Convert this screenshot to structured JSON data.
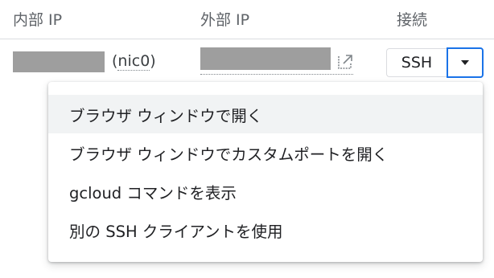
{
  "columns": {
    "internal_ip": "内部 IP",
    "external_ip": "外部 IP",
    "connect": "接続"
  },
  "row": {
    "nic": "nic0",
    "nic_open": "(",
    "nic_close": ")"
  },
  "connect_button": {
    "label": "SSH"
  },
  "menu": {
    "items": [
      {
        "label": "ブラウザ ウィンドウで開く"
      },
      {
        "label": "ブラウザ ウィンドウでカスタムポートを開く"
      },
      {
        "label": "gcloud コマンドを表示"
      },
      {
        "label": "別の SSH クライアントを使用"
      }
    ]
  },
  "colors": {
    "accent": "#1a73e8",
    "header_text": "#5f6368",
    "redaction": "#9e9e9e"
  },
  "icons": {
    "external_link": "open-in-new-icon",
    "dropdown": "arrow-drop-down-icon"
  }
}
